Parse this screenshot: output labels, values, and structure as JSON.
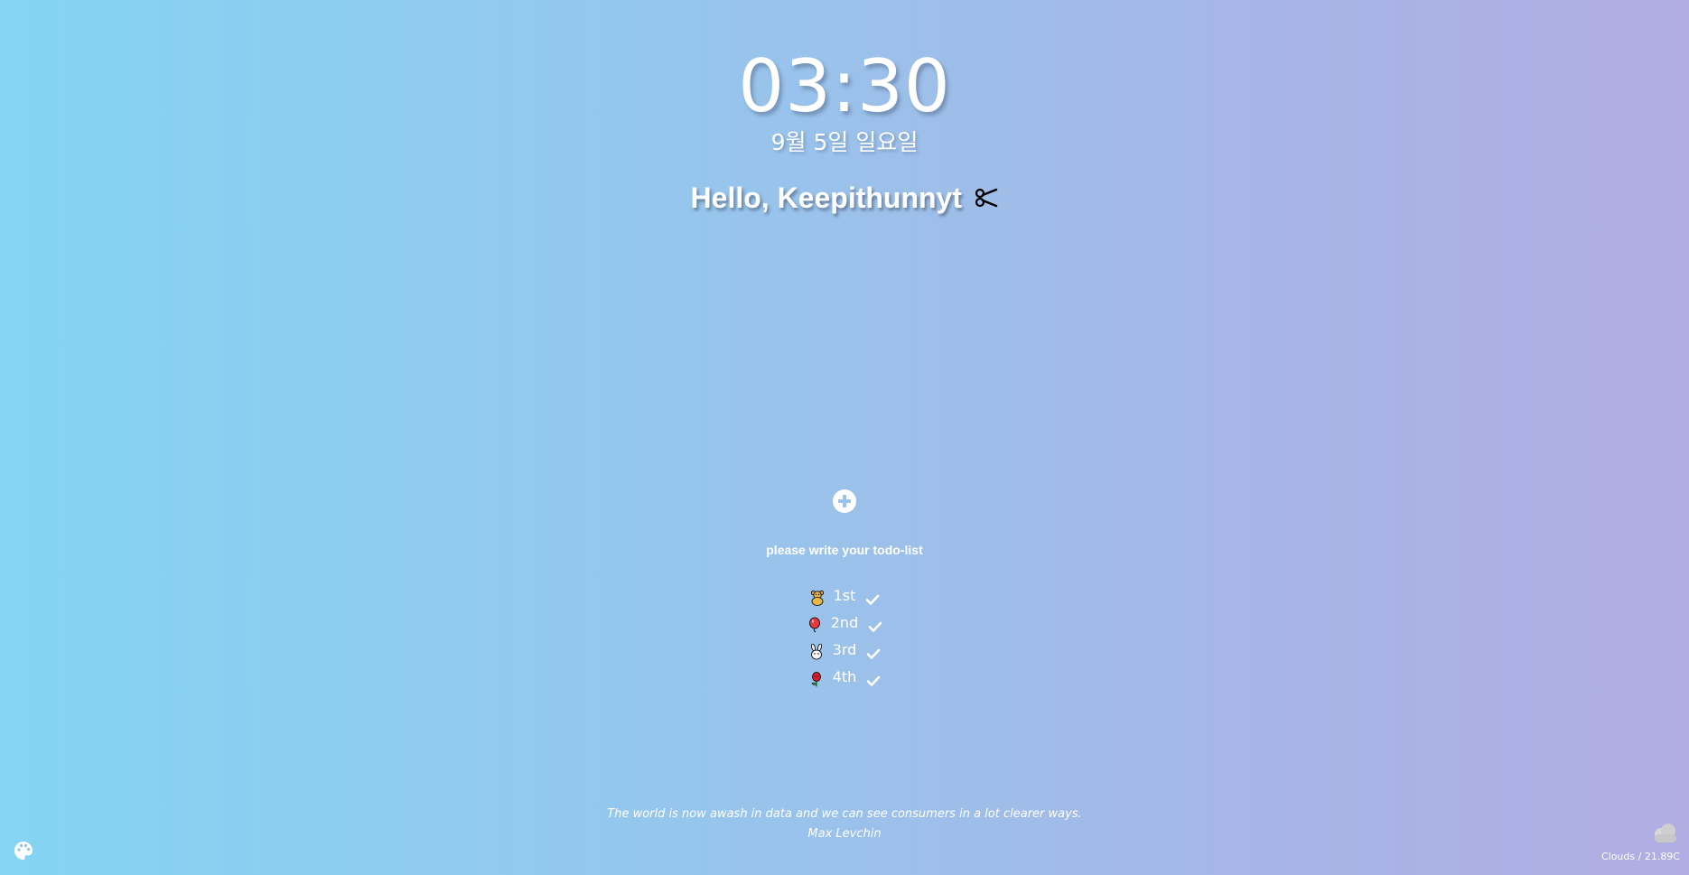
{
  "clock": {
    "time": "03:30",
    "date": "9월 5일 일요일"
  },
  "greeting": {
    "text": "Hello, Keepithunnyt"
  },
  "todo": {
    "prompt": "please write your todo-list",
    "items": [
      {
        "label": "1st",
        "icon": "teddy-bear-icon"
      },
      {
        "label": "2nd",
        "icon": "balloon-icon"
      },
      {
        "label": "3rd",
        "icon": "rabbit-icon"
      },
      {
        "label": "4th",
        "icon": "rose-icon"
      }
    ]
  },
  "quote": {
    "text": "The world is now awash in data and we can see consumers in a lot clearer ways.",
    "author": "Max Levchin"
  },
  "weather": {
    "text": "Clouds / 21.89C",
    "icon": "cloud-icon"
  },
  "colors": {
    "gradient_start": "#84d4f3",
    "gradient_end": "#b1ade2",
    "text": "#ffffff"
  }
}
